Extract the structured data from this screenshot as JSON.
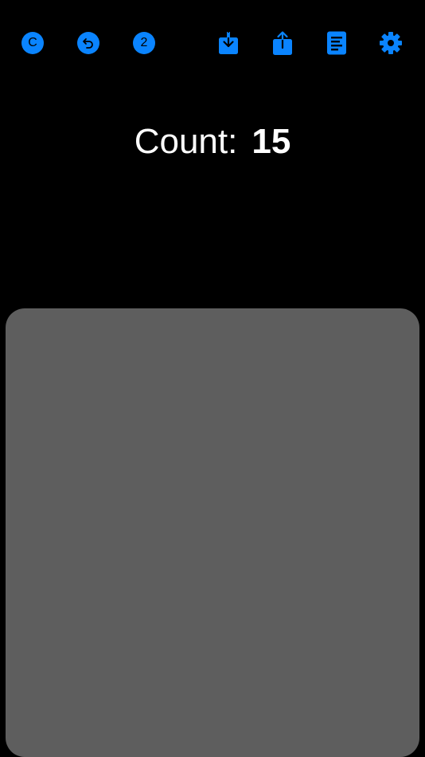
{
  "toolbar": {
    "clear_letter": "C",
    "multiplier_value": "2",
    "icons": [
      "clear-icon",
      "undo-icon",
      "multiplier-icon",
      "import-icon",
      "share-icon",
      "log-icon",
      "gear-icon"
    ]
  },
  "counter": {
    "label": "Count:",
    "value": "15"
  },
  "colors": {
    "accent": "#0a84ff",
    "background": "#000000",
    "tap_area": "#5e5e5e",
    "text": "#ffffff"
  }
}
